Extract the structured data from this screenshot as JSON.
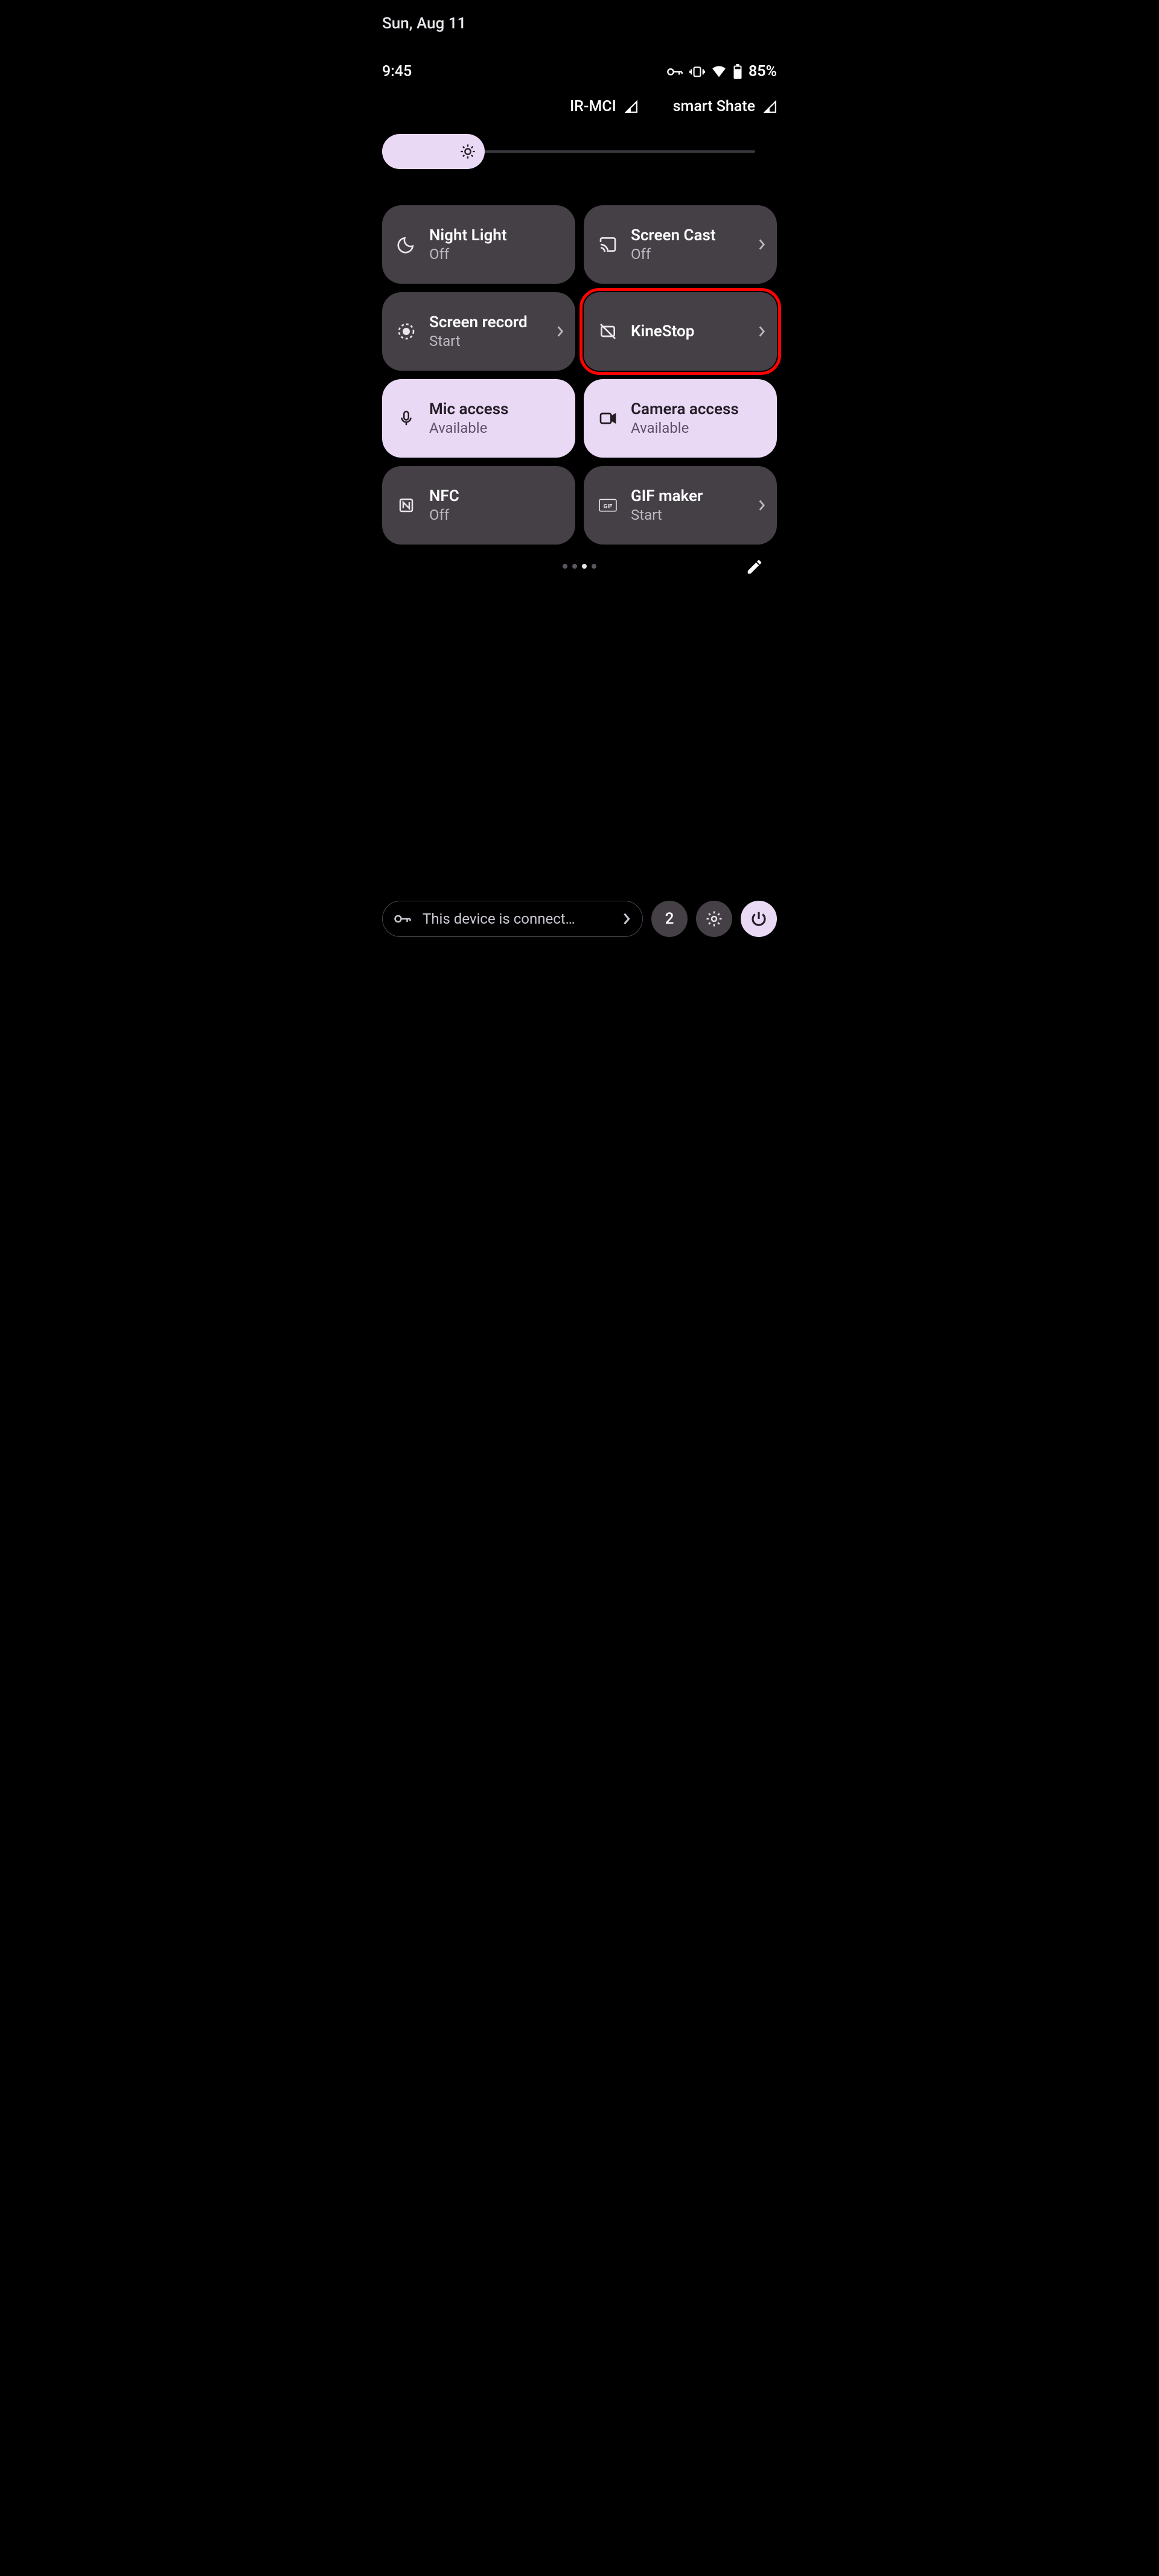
{
  "date": "Sun, Aug 11",
  "time": "9:45",
  "battery": "85%",
  "carriers": [
    {
      "name": "IR-MCI"
    },
    {
      "name": "smart Shate"
    }
  ],
  "tiles": [
    {
      "title": "Night Light",
      "sub": "Off",
      "chevron": false,
      "active": false,
      "highlight": false,
      "icon": "moon"
    },
    {
      "title": "Screen Cast",
      "sub": "Off",
      "chevron": true,
      "active": false,
      "highlight": false,
      "icon": "cast"
    },
    {
      "title": "Screen record",
      "sub": "Start",
      "chevron": true,
      "active": false,
      "highlight": false,
      "icon": "record"
    },
    {
      "title": "KineStop",
      "sub": "",
      "chevron": true,
      "active": false,
      "highlight": true,
      "icon": "motion-off"
    },
    {
      "title": "Mic access",
      "sub": "Available",
      "chevron": false,
      "active": true,
      "highlight": false,
      "icon": "mic"
    },
    {
      "title": "Camera access",
      "sub": "Available",
      "chevron": false,
      "active": true,
      "highlight": false,
      "icon": "camera"
    },
    {
      "title": "NFC",
      "sub": "Off",
      "chevron": false,
      "active": false,
      "highlight": false,
      "icon": "nfc"
    },
    {
      "title": "GIF maker",
      "sub": "Start",
      "chevron": true,
      "active": false,
      "highlight": false,
      "icon": "gif"
    }
  ],
  "page_dots": {
    "count": 4,
    "active": 2
  },
  "notification": "This device is connect…",
  "notif_count": "2"
}
